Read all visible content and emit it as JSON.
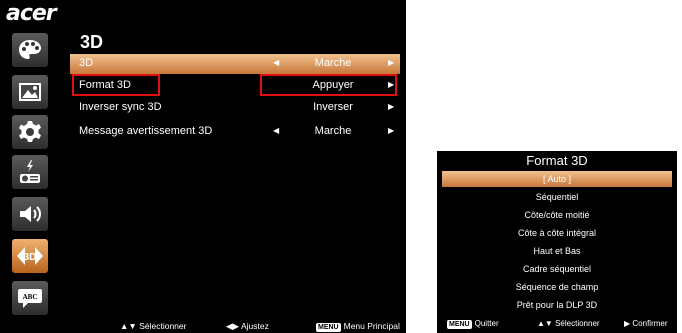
{
  "brand": {
    "logo_text": "acer"
  },
  "sidebar": {
    "items": [
      {
        "icon": "palette-icon"
      },
      {
        "icon": "image-icon"
      },
      {
        "icon": "gear-icon"
      },
      {
        "icon": "projector-power-icon"
      },
      {
        "icon": "speaker-icon"
      },
      {
        "icon": "3d-icon",
        "label": "3D",
        "active": true
      },
      {
        "icon": "language-icon",
        "label": "ABC"
      }
    ]
  },
  "page": {
    "title": "3D"
  },
  "menu": {
    "rows": [
      {
        "label": "3D",
        "value": "Marche",
        "left_arrow": "◀",
        "right_arrow": "▶"
      },
      {
        "label": "Format 3D",
        "value": "Appuyer",
        "left_arrow": "",
        "right_arrow": "▶"
      },
      {
        "label": "Inverser sync 3D",
        "value": "Inverser",
        "left_arrow": "",
        "right_arrow": "▶"
      },
      {
        "label": "Message avertissement 3D",
        "value": "Marche",
        "left_arrow": "◀",
        "right_arrow": "▶"
      }
    ]
  },
  "footer": {
    "select_glyph": "▲▼",
    "select_label": "Sélectionner",
    "adjust_glyph": "◀▶",
    "adjust_label": "Ajustez",
    "menu_key": "MENU",
    "menu_label": "Menu Principal"
  },
  "submenu": {
    "title": "Format 3D",
    "options": [
      "[ Auto ]",
      "Séquentiel",
      "Côte/côte moitié",
      "Côte à côte intégral",
      "Haut et Bas",
      "Cadre séquentiel",
      "Séquence de champ",
      "Prêt pour la DLP 3D"
    ],
    "selected_index": 0,
    "footer": {
      "menu_key": "MENU",
      "quit_label": "Quitter",
      "select_glyph": "▲▼",
      "select_label": "Sélectionner",
      "confirm_glyph": "▶",
      "confirm_label": "Confirmer"
    }
  },
  "colors": {
    "highlight": "#e01010",
    "selection": "#d98a48",
    "background": "#000000"
  }
}
